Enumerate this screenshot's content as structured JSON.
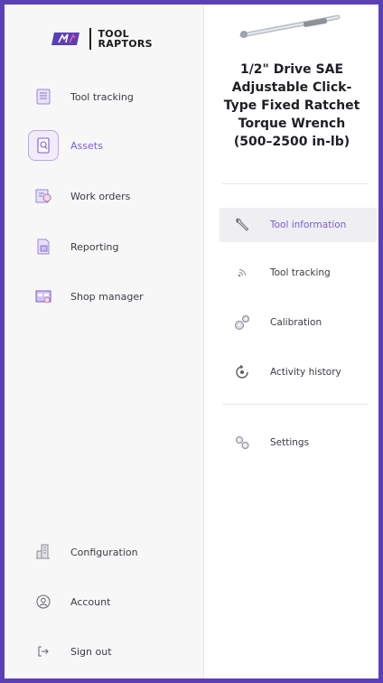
{
  "brand": {
    "line1": "TOOL",
    "line2": "RAPTORS"
  },
  "sidebar": {
    "items": [
      {
        "label": "Tool tracking",
        "icon": "tool-tracking-icon",
        "active": false
      },
      {
        "label": "Assets",
        "icon": "assets-icon",
        "active": true
      },
      {
        "label": "Work orders",
        "icon": "work-orders-icon",
        "active": false
      },
      {
        "label": "Reporting",
        "icon": "reporting-icon",
        "active": false
      },
      {
        "label": "Shop manager",
        "icon": "shop-manager-icon",
        "active": false
      }
    ],
    "bottom_items": [
      {
        "label": "Configuration",
        "icon": "configuration-icon"
      },
      {
        "label": "Account",
        "icon": "account-icon"
      },
      {
        "label": "Sign out",
        "icon": "sign-out-icon"
      }
    ]
  },
  "product": {
    "title": "1/2\" Drive SAE Adjustable Click-Type Fixed Ratchet Torque Wrench (500–2500 in-lb)"
  },
  "panel_menu": {
    "items": [
      {
        "label": "Tool information",
        "icon": "wrench-icon",
        "active": true
      },
      {
        "label": "Tool tracking",
        "icon": "signal-icon",
        "active": false
      },
      {
        "label": "Calibration",
        "icon": "gears-icon",
        "active": false
      },
      {
        "label": "Activity history",
        "icon": "history-icon",
        "active": false
      }
    ],
    "settings": {
      "label": "Settings",
      "icon": "settings-gears-icon"
    }
  },
  "colors": {
    "accent": "#7a5bd6",
    "frame": "#5a3fb5",
    "active_bg": "#efeff2"
  }
}
